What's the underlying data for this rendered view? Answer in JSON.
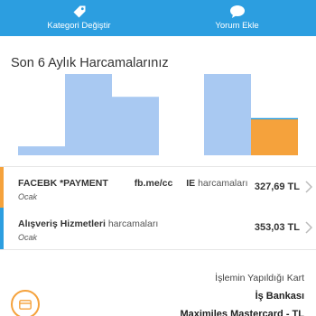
{
  "topbar": {
    "category_button_label": "Kategori Değiştir",
    "comment_button_label": "Yorum Ekle"
  },
  "section_title": "Son 6 Aylık Harcamalarınız",
  "chart_data": {
    "type": "bar",
    "groups": [
      {
        "series": [
          {
            "color": "#a9c9f2",
            "values": [
              11,
              100,
              72
            ]
          }
        ]
      },
      {
        "series": [
          {
            "color": "#a9c9f2",
            "values": [
              100
            ]
          },
          {
            "color": "#f5a23c",
            "values": [
              45
            ]
          }
        ]
      }
    ]
  },
  "transactions": [
    {
      "merchant_bold": "FACEBK *PAYMENT",
      "merchant_mid": "fb.me/cc",
      "merchant_tail_bold": "IE",
      "merchant_tail": "harcamaları",
      "month": "Ocak",
      "amount": "327,69 TL",
      "stripe_color": "#f5a23c"
    },
    {
      "merchant_bold": "Alışveriş Hizmetleri",
      "merchant_tail": "harcamaları",
      "month": "Ocak",
      "amount": "353,03 TL",
      "stripe_color": "#2c9ee0"
    }
  ],
  "card_info": {
    "label": "İşlemin Yapıldığı Kart",
    "bank": "İş Bankası",
    "card": "Maximiles Mastercard - TL"
  },
  "colors": {
    "accent": "#2c9ee0",
    "orange": "#f5a23c",
    "bar_blue": "#a9c9f2"
  }
}
